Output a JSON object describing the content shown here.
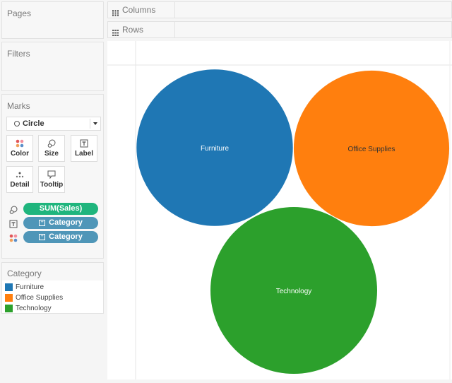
{
  "shelves": {
    "columns_label": "Columns",
    "rows_label": "Rows"
  },
  "cards": {
    "pages_title": "Pages",
    "filters_title": "Filters",
    "marks_title": "Marks"
  },
  "marks": {
    "mark_type": "Circle",
    "buttons": [
      {
        "label": "Color",
        "icon": "color-icon"
      },
      {
        "label": "Size",
        "icon": "size-icon"
      },
      {
        "label": "Label",
        "icon": "label-icon"
      },
      {
        "label": "Detail",
        "icon": "detail-icon"
      },
      {
        "label": "Tooltip",
        "icon": "tooltip-icon"
      }
    ],
    "pills": [
      {
        "encoding": "size",
        "field": "SUM(Sales)",
        "color": "#1fb57d"
      },
      {
        "encoding": "label",
        "field": "Category",
        "color": "#4f96b8"
      },
      {
        "encoding": "color",
        "field": "Category",
        "color": "#4f96b8"
      }
    ]
  },
  "legend": {
    "title": "Category",
    "items": [
      {
        "label": "Furniture",
        "color": "#1f77b4"
      },
      {
        "label": "Office Supplies",
        "color": "#ff7f0e"
      },
      {
        "label": "Technology",
        "color": "#2ca02c"
      }
    ]
  },
  "chart_data": {
    "type": "bubble",
    "title": "",
    "size_measure": "SUM(Sales)",
    "color_dimension": "Category",
    "label_dimension": "Category",
    "categories": [
      "Furniture",
      "Office Supplies",
      "Technology"
    ],
    "relative_size": [
      0.88,
      0.87,
      1.0
    ],
    "colors": [
      "#1f77b4",
      "#ff7f0e",
      "#2ca02c"
    ],
    "label_colors": [
      "#ffffff",
      "#333333",
      "#ffffff"
    ],
    "grid": false,
    "legend_position": "left"
  }
}
